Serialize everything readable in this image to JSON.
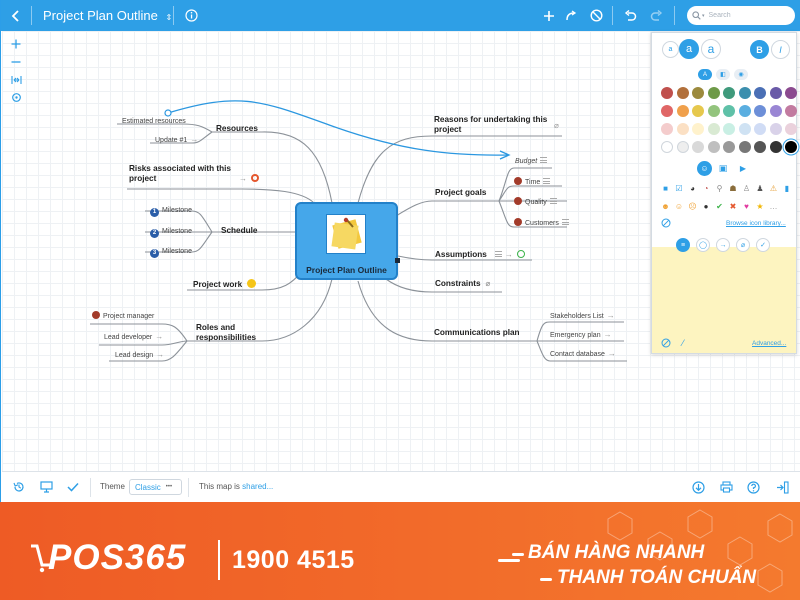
{
  "toolbar": {
    "back_icon": "chevron-left-icon",
    "title": "Project Plan Outline",
    "title_dropdown_icon": "updown-chevron-icon",
    "info_icon": "info-icon",
    "add_icon": "plus-icon",
    "relationship_icon": "relationship-arrow-icon",
    "remove_icon": "prohibit-icon",
    "undo_icon": "undo-icon",
    "redo_icon": "redo-icon",
    "search_placeholder": "Search"
  },
  "left_tools": {
    "zoom_in": "plus-icon",
    "zoom_out": "minus-icon",
    "fit": "fit-map-icon",
    "center": "target-icon"
  },
  "mindmap": {
    "central": "Project Plan Outline",
    "left": {
      "resources": {
        "label": "Resources",
        "children": [
          "Estimated resources",
          "Update #1"
        ]
      },
      "risks": {
        "label": "Risks associated with this project"
      },
      "schedule": {
        "label": "Schedule",
        "children": [
          "Milestone",
          "Milestone",
          "Milestone"
        ],
        "numbers": [
          "1",
          "2",
          "3"
        ]
      },
      "project_work": {
        "label": "Project work"
      },
      "roles": {
        "label": "Roles and responsibilities",
        "children": [
          "Project manager",
          "Lead developer",
          "Lead design"
        ]
      }
    },
    "right": {
      "reasons": {
        "label": "Reasons for undertaking this project"
      },
      "goals": {
        "label": "Project goals",
        "children": [
          "Budget",
          "Time",
          "Quality",
          "Customers"
        ]
      },
      "assumptions": {
        "label": "Assumptions"
      },
      "constraints": {
        "label": "Constraints"
      },
      "communications": {
        "label": "Communications plan",
        "children": [
          "Stakeholders List",
          "Emergency plan",
          "Contact database"
        ]
      }
    }
  },
  "panel": {
    "font_sizes": [
      "a",
      "a",
      "a"
    ],
    "bold": "B",
    "italic": "I",
    "browse_icons": "Browse icon library...",
    "advanced": "Advanced..."
  },
  "bottombar": {
    "history_icon": "history-icon",
    "present_icon": "presentation-icon",
    "check_icon": "checkmark-icon",
    "theme_label": "Theme",
    "theme_value": "Classic",
    "theme_more": "•••",
    "shared_prefix": "This map is",
    "shared_link": "shared...",
    "download_icon": "download-icon",
    "print_icon": "print-icon",
    "help_icon": "help-icon",
    "panel_toggle_icon": "panel-toggle-icon"
  },
  "banner": {
    "logo": "POS365",
    "phone": "1900 4515",
    "slogan_line1": "BÁN HÀNG NHANH",
    "slogan_line2": "THANH TOÁN CHUẨN"
  },
  "colors": {
    "accent": "#2e9fe6",
    "central_fill": "#45a7ea",
    "banner_orange": "#f26b2a",
    "note_yellow": "#fdf4c0"
  }
}
